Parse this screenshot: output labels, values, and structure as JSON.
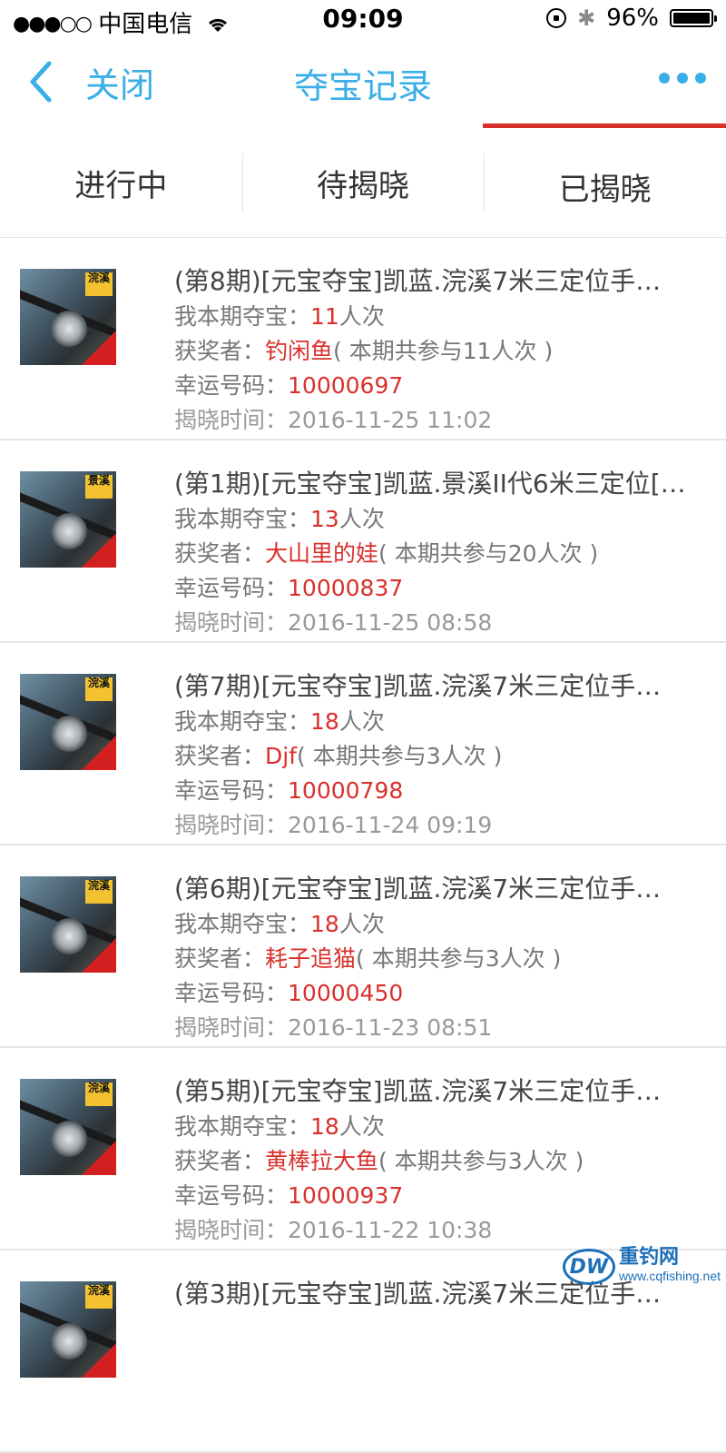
{
  "status_bar": {
    "signal_dots": "●●●○○",
    "carrier": "中国电信",
    "time": "09:09",
    "battery_percent": "96%"
  },
  "nav": {
    "back_label": "关闭",
    "title": "夺宝记录",
    "accent_color": "#3aaee6"
  },
  "tabs": [
    {
      "label": "进行中"
    },
    {
      "label": "待揭晓"
    },
    {
      "label": "已揭晓"
    }
  ],
  "active_tab": "已揭晓",
  "records": [
    {
      "title": "(第8期)[元宝夺宝]凯蓝.浣溪7米三定位手…",
      "my_label": "我本期夺宝：",
      "my_count": "11",
      "my_unit": "人次",
      "winner_label": "获奖者：",
      "winner": "钓闲鱼",
      "participants": "( 本期共参与11人次 )",
      "lucky_label": "幸运号码：",
      "lucky_number": "10000697",
      "time_label": "揭晓时间：",
      "time": "2016-11-25 11:02",
      "thumb_badge": "浣溪"
    },
    {
      "title": "(第1期)[元宝夺宝]凯蓝.景溪II代6米三定位[…",
      "my_label": "我本期夺宝：",
      "my_count": "13",
      "my_unit": "人次",
      "winner_label": "获奖者：",
      "winner": "大山里的娃",
      "participants": "( 本期共参与20人次 )",
      "lucky_label": "幸运号码：",
      "lucky_number": "10000837",
      "time_label": "揭晓时间：",
      "time": "2016-11-25 08:58",
      "thumb_badge": "景溪"
    },
    {
      "title": "(第7期)[元宝夺宝]凯蓝.浣溪7米三定位手…",
      "my_label": "我本期夺宝：",
      "my_count": "18",
      "my_unit": "人次",
      "winner_label": "获奖者：",
      "winner": "Djf",
      "participants": "( 本期共参与3人次 )",
      "lucky_label": "幸运号码：",
      "lucky_number": "10000798",
      "time_label": "揭晓时间：",
      "time": "2016-11-24 09:19",
      "thumb_badge": "浣溪"
    },
    {
      "title": "(第6期)[元宝夺宝]凯蓝.浣溪7米三定位手…",
      "my_label": "我本期夺宝：",
      "my_count": "18",
      "my_unit": "人次",
      "winner_label": "获奖者：",
      "winner": "耗子追猫",
      "participants": "( 本期共参与3人次 )",
      "lucky_label": "幸运号码：",
      "lucky_number": "10000450",
      "time_label": "揭晓时间：",
      "time": "2016-11-23 08:51",
      "thumb_badge": "浣溪"
    },
    {
      "title": "(第5期)[元宝夺宝]凯蓝.浣溪7米三定位手…",
      "my_label": "我本期夺宝：",
      "my_count": "18",
      "my_unit": "人次",
      "winner_label": "获奖者：",
      "winner": "黄棒拉大鱼",
      "participants": "( 本期共参与3人次 )",
      "lucky_label": "幸运号码：",
      "lucky_number": "10000937",
      "time_label": "揭晓时间：",
      "time": "2016-11-22 10:38",
      "thumb_badge": "浣溪"
    },
    {
      "title": "(第3期)[元宝夺宝]凯蓝.浣溪7米三定位手…",
      "my_label": "",
      "my_count": "",
      "my_unit": "",
      "winner_label": "",
      "winner": "",
      "participants": "",
      "lucky_label": "",
      "lucky_number": "",
      "time_label": "",
      "time": "",
      "thumb_badge": "浣溪"
    }
  ],
  "watermark": {
    "logo": "DW",
    "name": "重钓网",
    "url": "www.cqfishing.net"
  }
}
